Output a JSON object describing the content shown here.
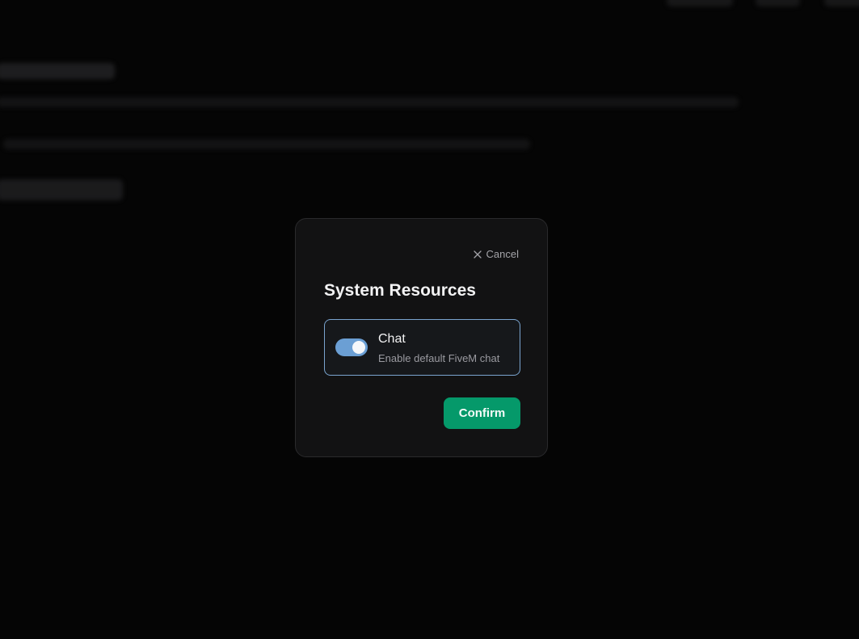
{
  "modal": {
    "cancel_label": "Cancel",
    "title": "System Resources",
    "option": {
      "title": "Chat",
      "description": "Enable default FiveM chat",
      "enabled": true
    },
    "confirm_label": "Confirm"
  },
  "colors": {
    "accent_toggle": "#6b9fd4",
    "confirm_button": "#05996a",
    "card_border": "#7aa4cf",
    "modal_background": "#121213"
  },
  "icons": {
    "cancel": "close-icon"
  }
}
